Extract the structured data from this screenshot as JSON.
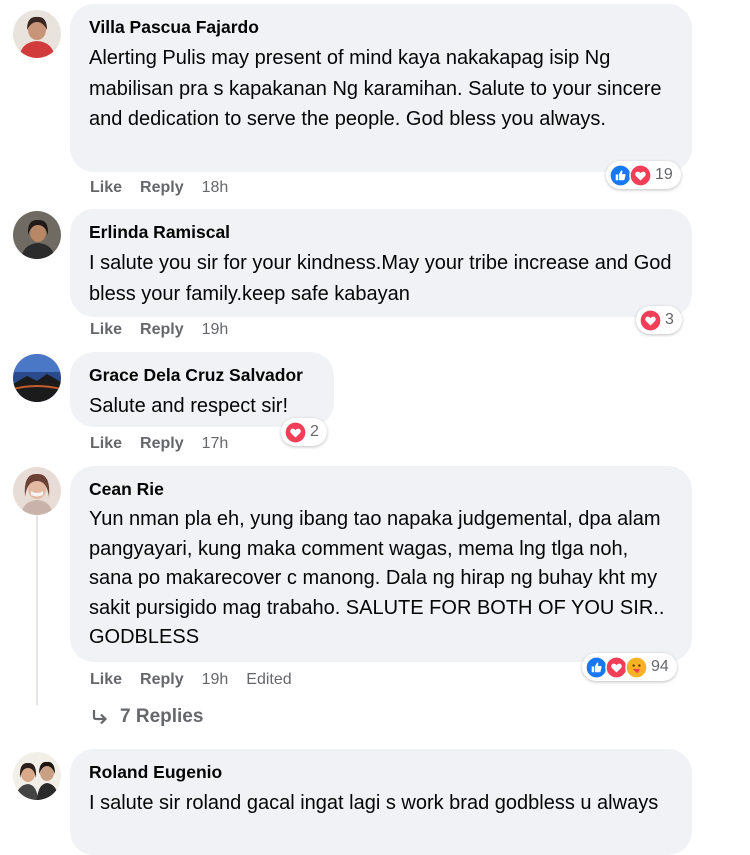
{
  "comments": [
    {
      "author": "Villa Pascua Fajardo",
      "text": "Alerting Pulis may present of mind kaya nakakapag isip Ng mabilisan pra s kapakanan Ng karamihan. Salute to your sincere and dedication to serve the people. God bless you always.",
      "like": "Like",
      "reply": "Reply",
      "time": "18h",
      "reaction_count": "19"
    },
    {
      "author": "Erlinda Ramiscal",
      "text": "I salute you sir for your kindness.May your tribe increase and God bless your family.keep safe kabayan",
      "like": "Like",
      "reply": "Reply",
      "time": "19h",
      "reaction_count": "3"
    },
    {
      "author": "Grace Dela Cruz Salvador",
      "text": "Salute and respect sir!",
      "like": "Like",
      "reply": "Reply",
      "time": "17h",
      "reaction_count": "2"
    },
    {
      "author": "Cean Rie",
      "text": "Yun nman pla eh, yung ibang tao napaka judgemental, dpa alam pangyayari, kung maka comment wagas, mema lng tlga noh, sana po makarecover c manong. Dala ng hirap ng buhay kht my sakit pursigido mag trabaho. SALUTE FOR BOTH OF YOU SIR.. GODBLESS",
      "like": "Like",
      "reply": "Reply",
      "time": "19h",
      "edited": "Edited",
      "reaction_count": "94",
      "replies_label": "7 Replies"
    },
    {
      "author": "Roland Eugenio",
      "text": "I salute sir roland gacal ingat lagi s work brad godbless u always"
    }
  ],
  "colors": {
    "like": "#1877f2",
    "love": "#f33e58",
    "care": "#f7b125",
    "meta": "#65676b",
    "bubble": "#f0f2f5"
  },
  "icons": [
    "like-reaction-icon",
    "love-reaction-icon",
    "care-reaction-icon",
    "reply-arrow-icon"
  ]
}
